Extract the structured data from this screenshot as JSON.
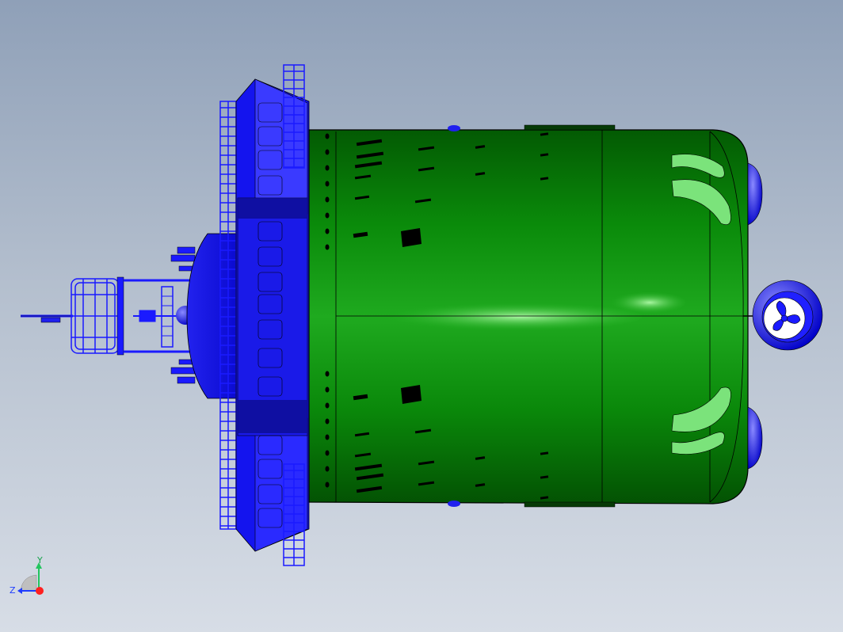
{
  "viewport": {
    "background_top": "#8fa0b8",
    "background_bottom": "#d7dde6"
  },
  "model": {
    "hull_color": "#119a11",
    "hull_dark": "#034f03",
    "superstructure_color": "#1a1aff",
    "outline_color": "#000000"
  },
  "triad": {
    "y_label": "Y",
    "z_label": "Z",
    "y_color": "#22c55e",
    "z_color": "#1e3cff",
    "x_color": "#ff2020"
  }
}
